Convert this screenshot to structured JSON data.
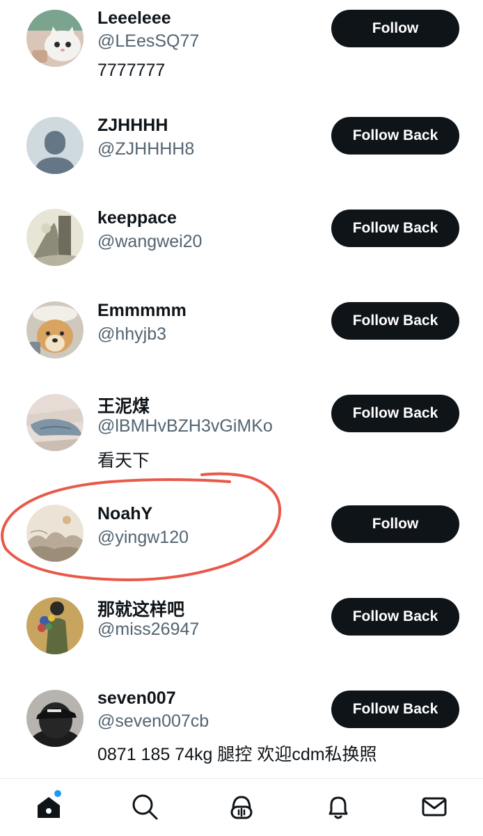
{
  "users": [
    {
      "name": "Leeeleee",
      "handle": "@LEesSQ77",
      "bio": "7777777",
      "button": "Follow",
      "avatar": "cat-avatar"
    },
    {
      "name": "ZJHHHH",
      "handle": "@ZJHHHH8",
      "bio": "",
      "button": "Follow Back",
      "avatar": "default-avatar"
    },
    {
      "name": "keeppace",
      "handle": "@wangwei20",
      "bio": "",
      "button": "Follow Back",
      "avatar": "sketch-avatar"
    },
    {
      "name": "Emmmmm",
      "handle": "@hhyjb3",
      "bio": "",
      "button": "Follow Back",
      "avatar": "dog-avatar"
    },
    {
      "name": "王泥煤",
      "handle": "@lBMHvBZH3vGiMKo",
      "bio": "看天下",
      "button": "Follow Back",
      "avatar": "fish-avatar"
    },
    {
      "name": "NoahY",
      "handle": "@yingw120",
      "bio": "",
      "button": "Follow",
      "avatar": "landscape-avatar"
    },
    {
      "name": "那就这样吧",
      "handle": "@miss26947",
      "bio": "",
      "button": "Follow Back",
      "avatar": "illustration-avatar"
    },
    {
      "name": "seven007",
      "handle": "@seven007cb",
      "bio": "0871 185 74kg 腿控 欢迎cdm私换照",
      "button": "Follow Back",
      "avatar": "cap-avatar"
    }
  ],
  "tabbar": {
    "items": [
      "home-icon",
      "search-icon",
      "spaces-icon",
      "notifications-icon",
      "messages-icon"
    ],
    "home_badge_color": "#1d9bf0"
  },
  "colors": {
    "button_bg": "#0f1419",
    "handle": "#536471",
    "annotation": "#e8594a"
  }
}
